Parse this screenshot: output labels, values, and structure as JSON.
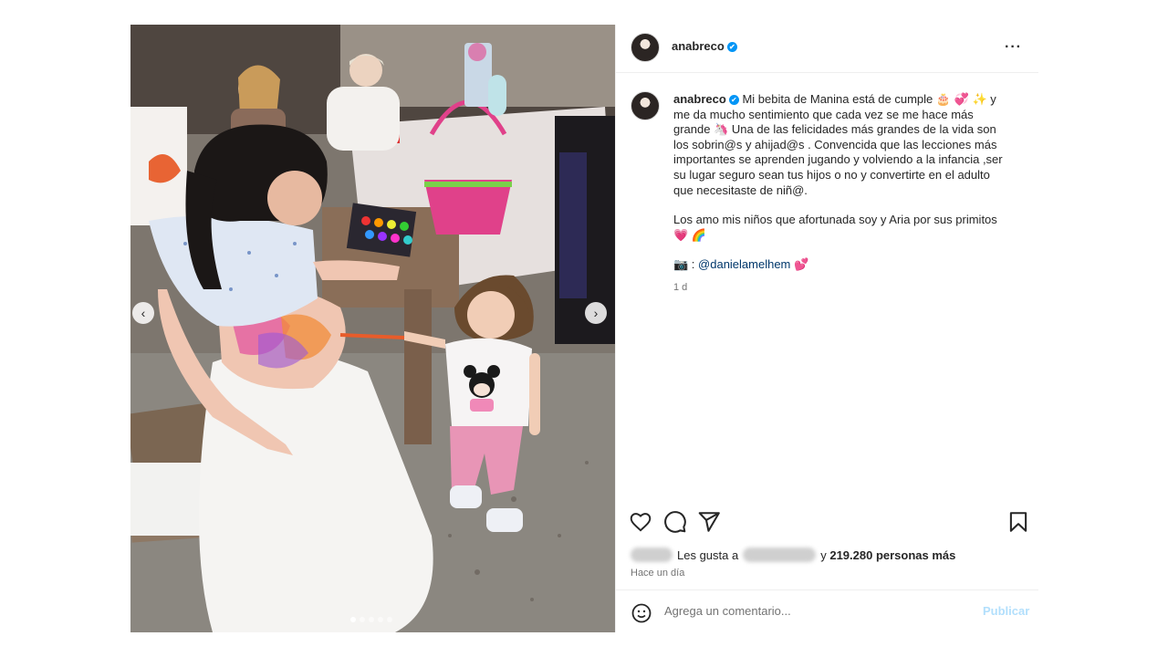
{
  "post": {
    "username": "anabreco",
    "verified_mark": "✔",
    "more_icon": "···",
    "caption_user": "anabreco",
    "caption_p1": "Mi bebita de Manina está de cumple 🎂 💞 ✨ y me da mucho sentimiento que cada vez se me hace más grande 🦄 Una de las felicidades más grandes de la vida son los sobrin@s y ahijad@s . Convencida que las lecciones más importantes se aprenden jugando y volviendo a la infancia ,ser su lugar seguro sean tus hijos o no y convertirte en el adulto que necesitaste de niñ@.",
    "caption_p2": "Los amo mis niños que afortunada soy y Aria por sus primitos 💗 🌈",
    "credit_prefix": "📷 : ",
    "credit_mention": "@danielamelhem",
    "credit_suffix": " 💕",
    "caption_time": "1 d",
    "likes_prefix": "Les gusta a",
    "likes_middle": "y",
    "likes_count": "219.280 personas más",
    "time_label": "Hace un día",
    "comment_placeholder": "Agrega un comentario...",
    "post_button": "Publicar"
  },
  "carousel": {
    "prev_glyph": "‹",
    "next_glyph": "›",
    "slides": 5,
    "active_index": 0
  },
  "colors": {
    "verified_blue": "#0095f6",
    "mention_blue": "#00376b",
    "post_disabled": "#b2dffc"
  }
}
